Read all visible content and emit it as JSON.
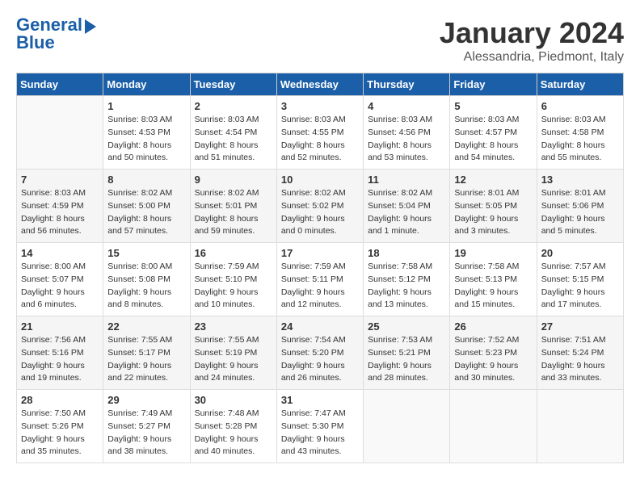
{
  "header": {
    "logo_line1": "General",
    "logo_line2": "Blue",
    "month": "January 2024",
    "location": "Alessandria, Piedmont, Italy"
  },
  "columns": [
    "Sunday",
    "Monday",
    "Tuesday",
    "Wednesday",
    "Thursday",
    "Friday",
    "Saturday"
  ],
  "weeks": [
    [
      {
        "day": "",
        "sunrise": "",
        "sunset": "",
        "daylight": ""
      },
      {
        "day": "1",
        "sunrise": "Sunrise: 8:03 AM",
        "sunset": "Sunset: 4:53 PM",
        "daylight": "Daylight: 8 hours and 50 minutes."
      },
      {
        "day": "2",
        "sunrise": "Sunrise: 8:03 AM",
        "sunset": "Sunset: 4:54 PM",
        "daylight": "Daylight: 8 hours and 51 minutes."
      },
      {
        "day": "3",
        "sunrise": "Sunrise: 8:03 AM",
        "sunset": "Sunset: 4:55 PM",
        "daylight": "Daylight: 8 hours and 52 minutes."
      },
      {
        "day": "4",
        "sunrise": "Sunrise: 8:03 AM",
        "sunset": "Sunset: 4:56 PM",
        "daylight": "Daylight: 8 hours and 53 minutes."
      },
      {
        "day": "5",
        "sunrise": "Sunrise: 8:03 AM",
        "sunset": "Sunset: 4:57 PM",
        "daylight": "Daylight: 8 hours and 54 minutes."
      },
      {
        "day": "6",
        "sunrise": "Sunrise: 8:03 AM",
        "sunset": "Sunset: 4:58 PM",
        "daylight": "Daylight: 8 hours and 55 minutes."
      }
    ],
    [
      {
        "day": "7",
        "sunrise": "Sunrise: 8:03 AM",
        "sunset": "Sunset: 4:59 PM",
        "daylight": "Daylight: 8 hours and 56 minutes."
      },
      {
        "day": "8",
        "sunrise": "Sunrise: 8:02 AM",
        "sunset": "Sunset: 5:00 PM",
        "daylight": "Daylight: 8 hours and 57 minutes."
      },
      {
        "day": "9",
        "sunrise": "Sunrise: 8:02 AM",
        "sunset": "Sunset: 5:01 PM",
        "daylight": "Daylight: 8 hours and 59 minutes."
      },
      {
        "day": "10",
        "sunrise": "Sunrise: 8:02 AM",
        "sunset": "Sunset: 5:02 PM",
        "daylight": "Daylight: 9 hours and 0 minutes."
      },
      {
        "day": "11",
        "sunrise": "Sunrise: 8:02 AM",
        "sunset": "Sunset: 5:04 PM",
        "daylight": "Daylight: 9 hours and 1 minute."
      },
      {
        "day": "12",
        "sunrise": "Sunrise: 8:01 AM",
        "sunset": "Sunset: 5:05 PM",
        "daylight": "Daylight: 9 hours and 3 minutes."
      },
      {
        "day": "13",
        "sunrise": "Sunrise: 8:01 AM",
        "sunset": "Sunset: 5:06 PM",
        "daylight": "Daylight: 9 hours and 5 minutes."
      }
    ],
    [
      {
        "day": "14",
        "sunrise": "Sunrise: 8:00 AM",
        "sunset": "Sunset: 5:07 PM",
        "daylight": "Daylight: 9 hours and 6 minutes."
      },
      {
        "day": "15",
        "sunrise": "Sunrise: 8:00 AM",
        "sunset": "Sunset: 5:08 PM",
        "daylight": "Daylight: 9 hours and 8 minutes."
      },
      {
        "day": "16",
        "sunrise": "Sunrise: 7:59 AM",
        "sunset": "Sunset: 5:10 PM",
        "daylight": "Daylight: 9 hours and 10 minutes."
      },
      {
        "day": "17",
        "sunrise": "Sunrise: 7:59 AM",
        "sunset": "Sunset: 5:11 PM",
        "daylight": "Daylight: 9 hours and 12 minutes."
      },
      {
        "day": "18",
        "sunrise": "Sunrise: 7:58 AM",
        "sunset": "Sunset: 5:12 PM",
        "daylight": "Daylight: 9 hours and 13 minutes."
      },
      {
        "day": "19",
        "sunrise": "Sunrise: 7:58 AM",
        "sunset": "Sunset: 5:13 PM",
        "daylight": "Daylight: 9 hours and 15 minutes."
      },
      {
        "day": "20",
        "sunrise": "Sunrise: 7:57 AM",
        "sunset": "Sunset: 5:15 PM",
        "daylight": "Daylight: 9 hours and 17 minutes."
      }
    ],
    [
      {
        "day": "21",
        "sunrise": "Sunrise: 7:56 AM",
        "sunset": "Sunset: 5:16 PM",
        "daylight": "Daylight: 9 hours and 19 minutes."
      },
      {
        "day": "22",
        "sunrise": "Sunrise: 7:55 AM",
        "sunset": "Sunset: 5:17 PM",
        "daylight": "Daylight: 9 hours and 22 minutes."
      },
      {
        "day": "23",
        "sunrise": "Sunrise: 7:55 AM",
        "sunset": "Sunset: 5:19 PM",
        "daylight": "Daylight: 9 hours and 24 minutes."
      },
      {
        "day": "24",
        "sunrise": "Sunrise: 7:54 AM",
        "sunset": "Sunset: 5:20 PM",
        "daylight": "Daylight: 9 hours and 26 minutes."
      },
      {
        "day": "25",
        "sunrise": "Sunrise: 7:53 AM",
        "sunset": "Sunset: 5:21 PM",
        "daylight": "Daylight: 9 hours and 28 minutes."
      },
      {
        "day": "26",
        "sunrise": "Sunrise: 7:52 AM",
        "sunset": "Sunset: 5:23 PM",
        "daylight": "Daylight: 9 hours and 30 minutes."
      },
      {
        "day": "27",
        "sunrise": "Sunrise: 7:51 AM",
        "sunset": "Sunset: 5:24 PM",
        "daylight": "Daylight: 9 hours and 33 minutes."
      }
    ],
    [
      {
        "day": "28",
        "sunrise": "Sunrise: 7:50 AM",
        "sunset": "Sunset: 5:26 PM",
        "daylight": "Daylight: 9 hours and 35 minutes."
      },
      {
        "day": "29",
        "sunrise": "Sunrise: 7:49 AM",
        "sunset": "Sunset: 5:27 PM",
        "daylight": "Daylight: 9 hours and 38 minutes."
      },
      {
        "day": "30",
        "sunrise": "Sunrise: 7:48 AM",
        "sunset": "Sunset: 5:28 PM",
        "daylight": "Daylight: 9 hours and 40 minutes."
      },
      {
        "day": "31",
        "sunrise": "Sunrise: 7:47 AM",
        "sunset": "Sunset: 5:30 PM",
        "daylight": "Daylight: 9 hours and 43 minutes."
      },
      {
        "day": "",
        "sunrise": "",
        "sunset": "",
        "daylight": ""
      },
      {
        "day": "",
        "sunrise": "",
        "sunset": "",
        "daylight": ""
      },
      {
        "day": "",
        "sunrise": "",
        "sunset": "",
        "daylight": ""
      }
    ]
  ]
}
